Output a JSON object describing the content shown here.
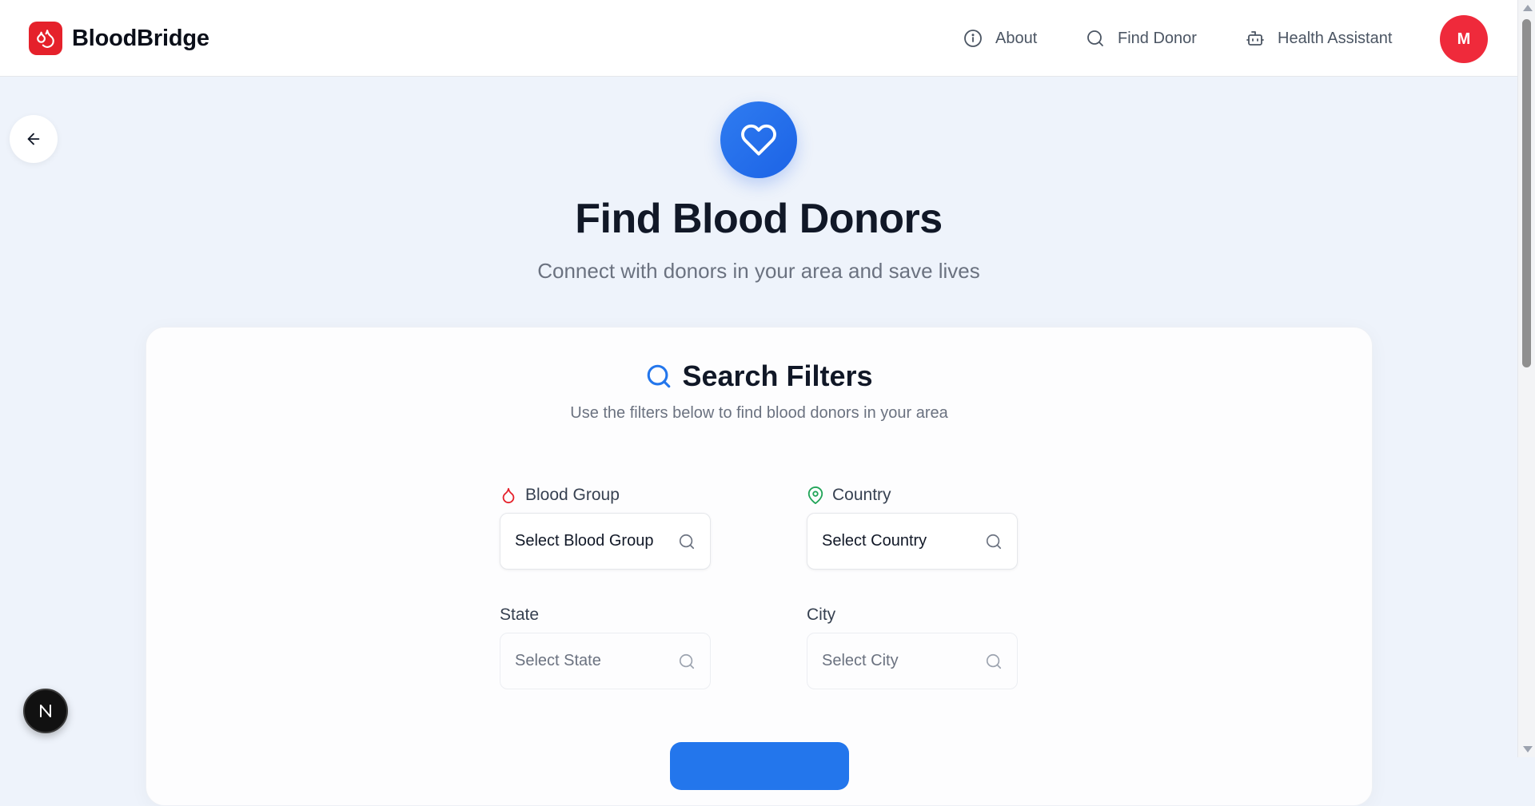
{
  "header": {
    "brand_name": "BloodBridge",
    "nav": [
      {
        "label": "About",
        "icon": "info-icon"
      },
      {
        "label": "Find Donor",
        "icon": "search-icon"
      },
      {
        "label": "Health Assistant",
        "icon": "robot-icon"
      }
    ],
    "avatar_initial": "M"
  },
  "hero": {
    "icon": "heart-icon",
    "title": "Find Blood Donors",
    "subtitle": "Connect with donors in your area and save lives"
  },
  "filters": {
    "title": "Search Filters",
    "subtitle": "Use the filters below to find blood donors in your area",
    "blood_group": {
      "label": "Blood Group",
      "value": "Select Blood Group",
      "icon": "blood-drop-icon"
    },
    "country": {
      "label": "Country",
      "value": "Select Country",
      "icon": "map-pin-icon"
    },
    "state": {
      "label": "State",
      "value": "Select State"
    },
    "city": {
      "label": "City",
      "value": "Select City"
    }
  },
  "colors": {
    "brand_red": "#e5212b",
    "primary_blue": "#2376ec",
    "pin_green": "#22a559",
    "page_bg": "#eef3fb"
  },
  "badge_letter": "N"
}
